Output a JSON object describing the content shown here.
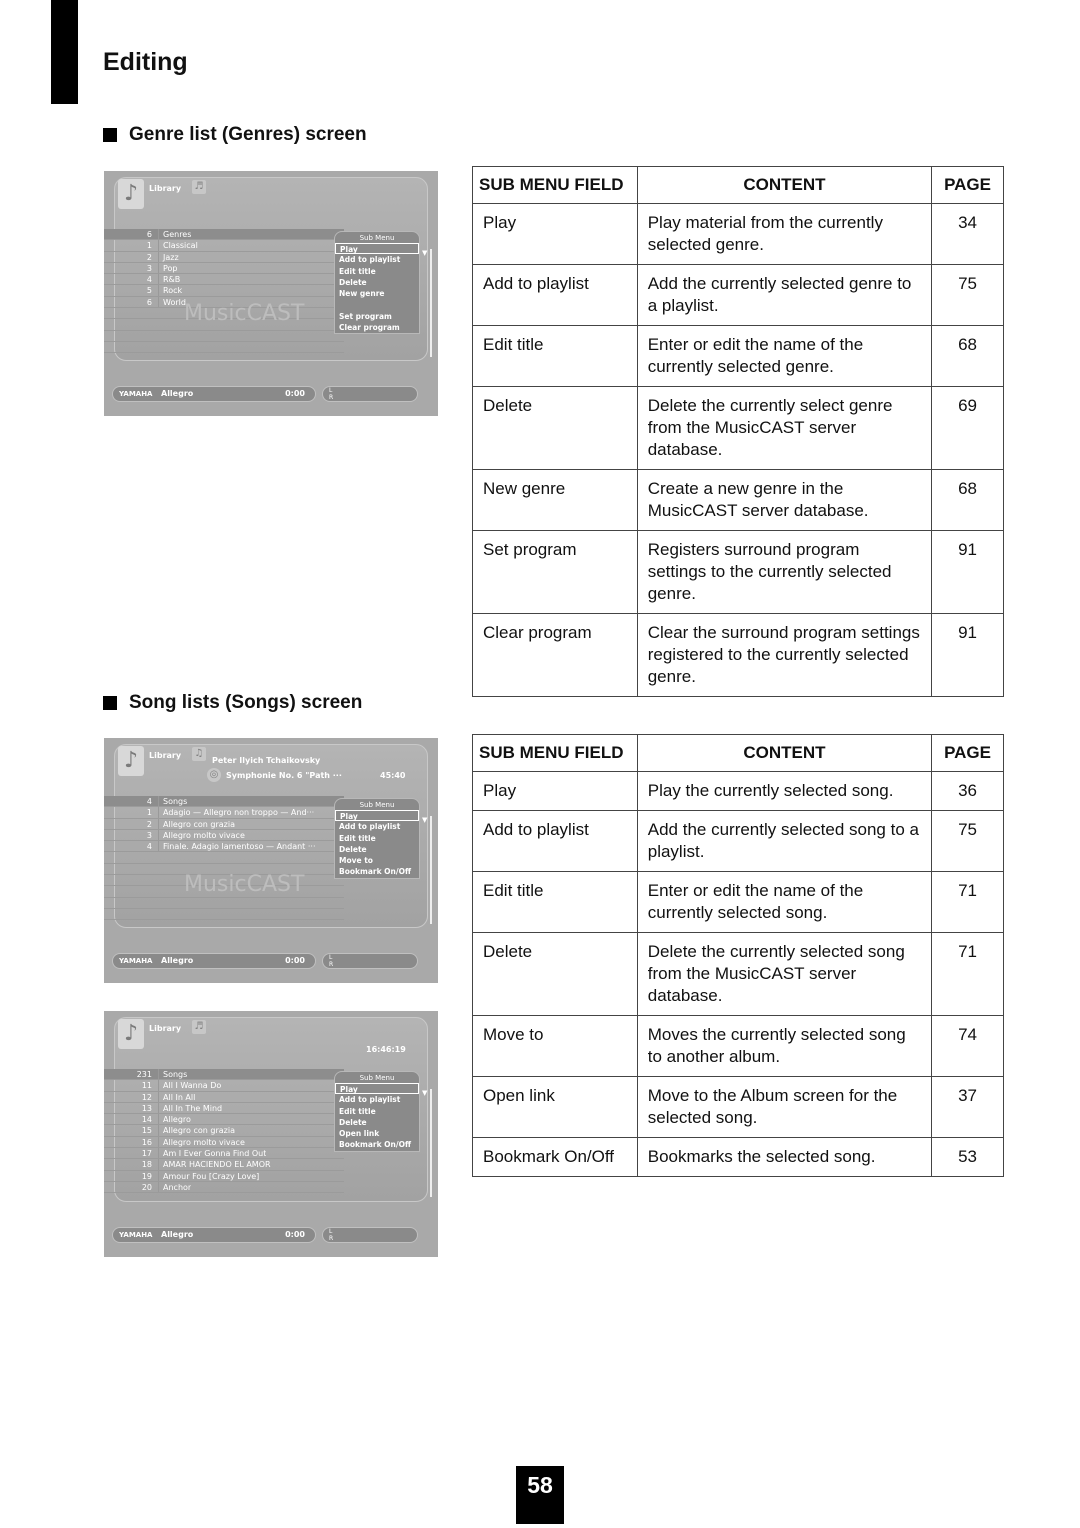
{
  "page": {
    "title": "Editing",
    "page_number": "58"
  },
  "sections": [
    {
      "heading": "Genre list (Genres) screen",
      "screen": {
        "header_label": "Library",
        "header_icon": "genre-icon",
        "list_header": {
          "count": "6",
          "label": "Genres"
        },
        "rows": [
          {
            "num": "1",
            "name": "Classical"
          },
          {
            "num": "2",
            "name": "Jazz"
          },
          {
            "num": "3",
            "name": "Pop"
          },
          {
            "num": "4",
            "name": "R&B"
          },
          {
            "num": "5",
            "name": "Rock"
          },
          {
            "num": "6",
            "name": "World"
          }
        ],
        "watermark": "MusicCAST",
        "submenu_title": "Sub Menu",
        "submenu": [
          "Play",
          "Add to playlist",
          "Edit title",
          "Delete",
          "New genre",
          "",
          "Set program",
          "Clear program"
        ],
        "footer": {
          "brand": "YAMAHA",
          "track": "Allegro",
          "time": "0:00"
        },
        "level_labels": [
          "L",
          "R"
        ]
      },
      "table": {
        "headers": [
          "SUB MENU FIELD",
          "CONTENT",
          "PAGE"
        ],
        "rows": [
          {
            "field": "Play",
            "content": "Play material from the currently selected genre.",
            "page": "34"
          },
          {
            "field": "Add to playlist",
            "content": "Add the currently selected genre to a playlist.",
            "page": "75"
          },
          {
            "field": "Edit title",
            "content": "Enter or edit the name of the currently selected genre.",
            "page": "68"
          },
          {
            "field": "Delete",
            "content": "Delete the currently select genre from the MusicCAST server database.",
            "page": "69"
          },
          {
            "field": "New genre",
            "content": "Create a new genre in the MusicCAST server database.",
            "page": "68"
          },
          {
            "field": "Set program",
            "content": "Registers surround program settings to the currently selected genre.",
            "page": "91"
          },
          {
            "field": "Clear program",
            "content": "Clear the surround program settings registered to the currently selected genre.",
            "page": "91"
          }
        ]
      }
    },
    {
      "heading": "Song lists (Songs) screen",
      "screen_album": {
        "header_label": "Library",
        "artist": "Peter Ilyich Tchaikovsky",
        "album": "Symphonie No. 6 \"Path ···",
        "duration": "45:40",
        "list_header": {
          "count": "4",
          "label": "Songs"
        },
        "rows": [
          {
            "num": "1",
            "name": "Adagio — Allegro non troppo — And···"
          },
          {
            "num": "2",
            "name": "Allegro con grazia"
          },
          {
            "num": "3",
            "name": "Allegro molto vivace"
          },
          {
            "num": "4",
            "name": "Finale. Adagio lamentoso — Andant ···"
          }
        ],
        "watermark": "MusicCAST",
        "submenu_title": "Sub Menu",
        "submenu": [
          "Play",
          "Add to playlist",
          "Edit title",
          "Delete",
          "Move to",
          "Bookmark On/Off"
        ],
        "footer": {
          "brand": "YAMAHA",
          "track": "Allegro",
          "time": "0:00"
        },
        "level_labels": [
          "L",
          "R"
        ]
      },
      "screen_all": {
        "header_label": "Library",
        "duration": "16:46:19",
        "list_header": {
          "count": "231",
          "label": "Songs"
        },
        "rows": [
          {
            "num": "11",
            "name": "All I Wanna Do"
          },
          {
            "num": "12",
            "name": "All In All"
          },
          {
            "num": "13",
            "name": "All In The Mind"
          },
          {
            "num": "14",
            "name": "Allegro"
          },
          {
            "num": "15",
            "name": "Allegro con grazia"
          },
          {
            "num": "16",
            "name": "Allegro molto vivace"
          },
          {
            "num": "17",
            "name": "Am I Ever Gonna Find Out"
          },
          {
            "num": "18",
            "name": "AMAR  HACIENDO  EL  AMOR"
          },
          {
            "num": "19",
            "name": "Amour Fou [Crazy Love]"
          },
          {
            "num": "20",
            "name": "Anchor"
          }
        ],
        "submenu_title": "Sub Menu",
        "submenu": [
          "Play",
          "Add to playlist",
          "Edit title",
          "Delete",
          "Open link",
          "Bookmark On/Off"
        ],
        "footer": {
          "brand": "YAMAHA",
          "track": "Allegro",
          "time": "0:00"
        },
        "level_labels": [
          "L",
          "R"
        ]
      },
      "table": {
        "headers": [
          "SUB MENU FIELD",
          "CONTENT",
          "PAGE"
        ],
        "rows": [
          {
            "field": "Play",
            "content": "Play the currently selected song.",
            "page": "36"
          },
          {
            "field": "Add to playlist",
            "content": "Add the currently selected song to a playlist.",
            "page": "75"
          },
          {
            "field": "Edit title",
            "content": "Enter or edit the name of the currently selected song.",
            "page": "71"
          },
          {
            "field": "Delete",
            "content": "Delete the currently selected song from the MusicCAST server database.",
            "page": "71"
          },
          {
            "field": "Move to",
            "content": "Moves the currently selected song to another album.",
            "page": "74"
          },
          {
            "field": "Open link",
            "content": "Move to the Album screen for the selected song.",
            "page": "37"
          },
          {
            "field": "Bookmark On/Off",
            "content": "Bookmarks the selected song.",
            "page": "53"
          }
        ]
      }
    }
  ]
}
